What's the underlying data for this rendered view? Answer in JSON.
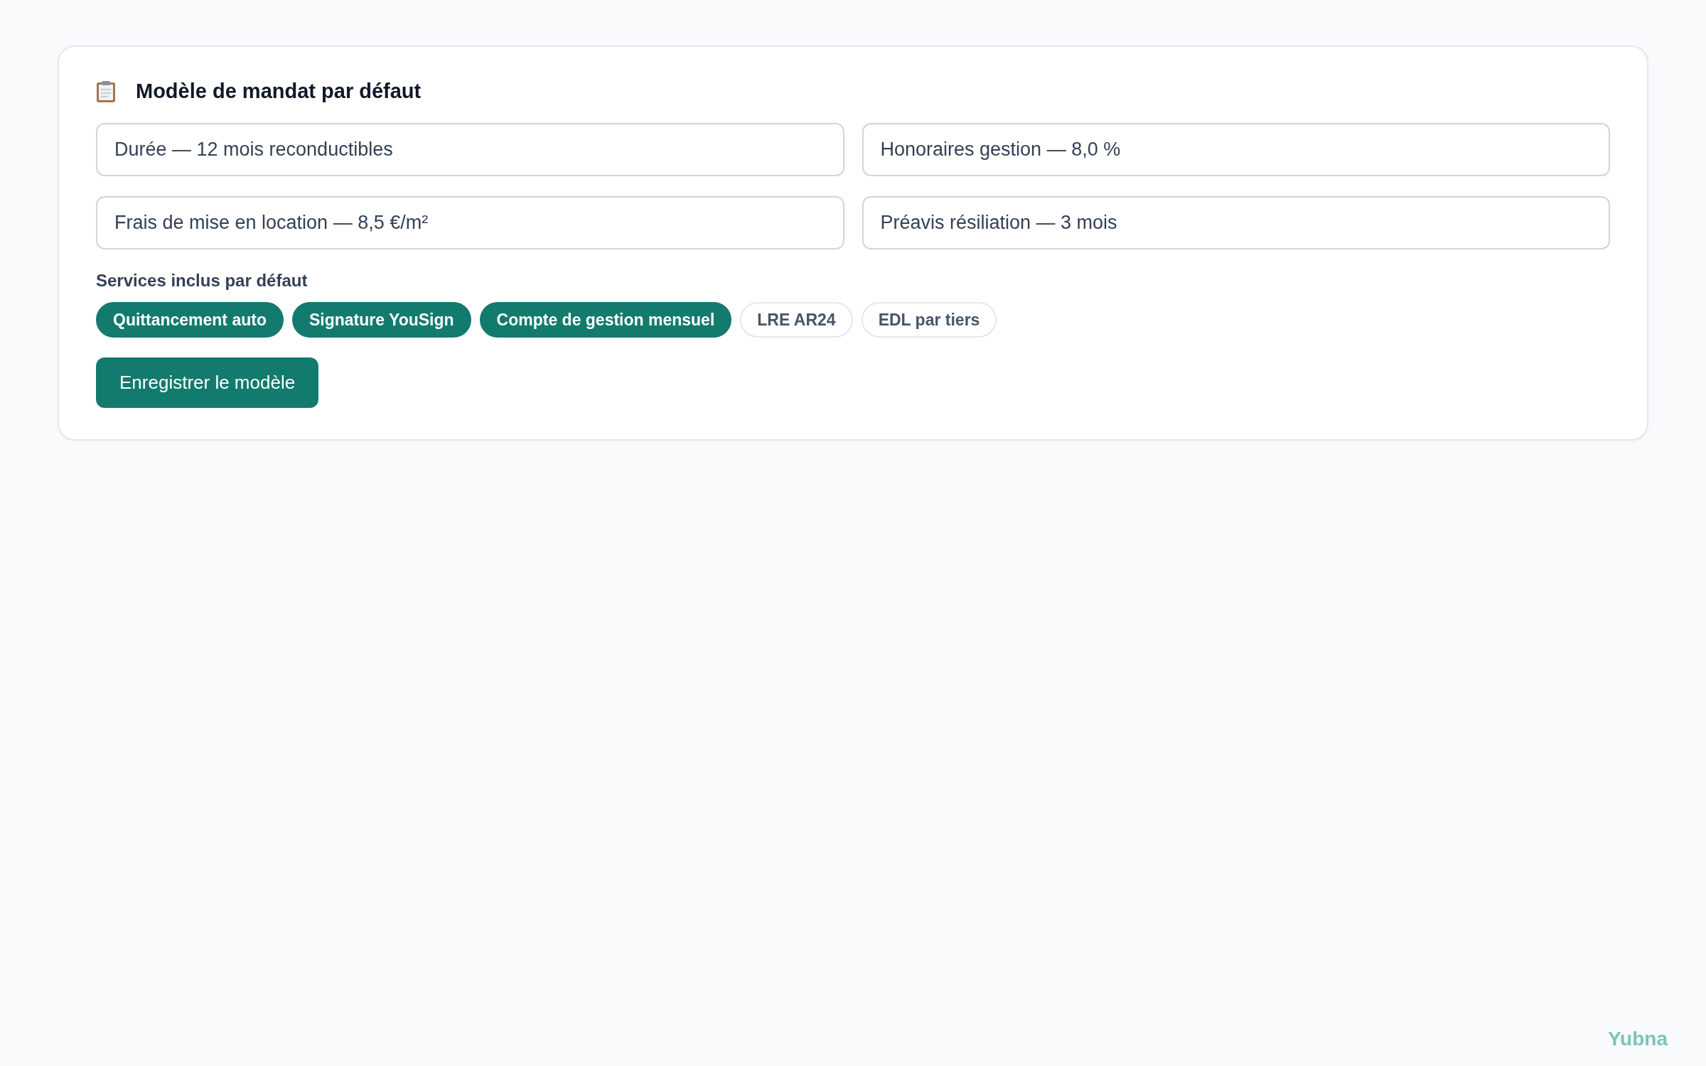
{
  "card": {
    "title": "Modèle de mandat par défaut",
    "fields": [
      {
        "value": "Durée — 12 mois reconductibles"
      },
      {
        "value": "Honoraires gestion — 8,0 %"
      },
      {
        "value": "Frais de mise en location — 8,5 €/m²"
      },
      {
        "value": "Préavis résiliation — 3 mois"
      }
    ],
    "services_label": "Services inclus par défaut",
    "services": [
      {
        "label": "Quittancement auto",
        "selected": true
      },
      {
        "label": "Signature YouSign",
        "selected": true
      },
      {
        "label": "Compte de gestion mensuel",
        "selected": true
      },
      {
        "label": "LRE AR24",
        "selected": false
      },
      {
        "label": "EDL par tiers",
        "selected": false
      }
    ],
    "save_button": "Enregistrer le modèle"
  },
  "brand": "Yubna"
}
